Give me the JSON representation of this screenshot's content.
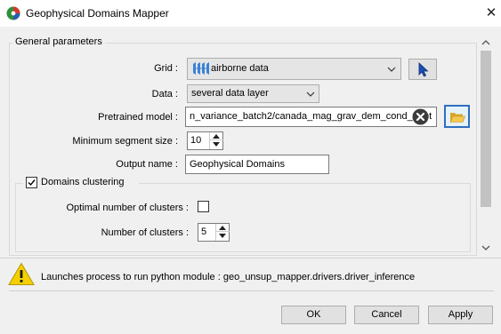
{
  "window": {
    "title": "Geophysical Domains Mapper",
    "close_glyph": "✕"
  },
  "general": {
    "group_label": "General parameters",
    "grid": {
      "label": "Grid :",
      "value": "airborne data"
    },
    "data": {
      "label": "Data :",
      "value": "several data layer"
    },
    "pretrained_model": {
      "label": "Pretrained model :",
      "value": "n_variance_batch2/canada_mag_grav_dem_cond_th.pt"
    },
    "min_segment": {
      "label": "Minimum segment size :",
      "value": "10"
    },
    "output_name": {
      "label": "Output name :",
      "value": "Geophysical Domains"
    },
    "clustering": {
      "label": "Domains clustering",
      "checked": true,
      "optimal": {
        "label": "Optimal number of clusters :",
        "checked": false
      },
      "num_clusters": {
        "label": "Number of clusters :",
        "value": "5"
      }
    }
  },
  "status": {
    "message": "Launches process to run python module : geo_unsup_mapper.drivers.driver_inference"
  },
  "buttons": {
    "ok": "OK",
    "cancel": "Cancel",
    "apply": "Apply"
  },
  "colors": {
    "folder_accent": "#2d6fc0",
    "warning": "#f5d000",
    "cursor_blue": "#1a4fb8"
  }
}
